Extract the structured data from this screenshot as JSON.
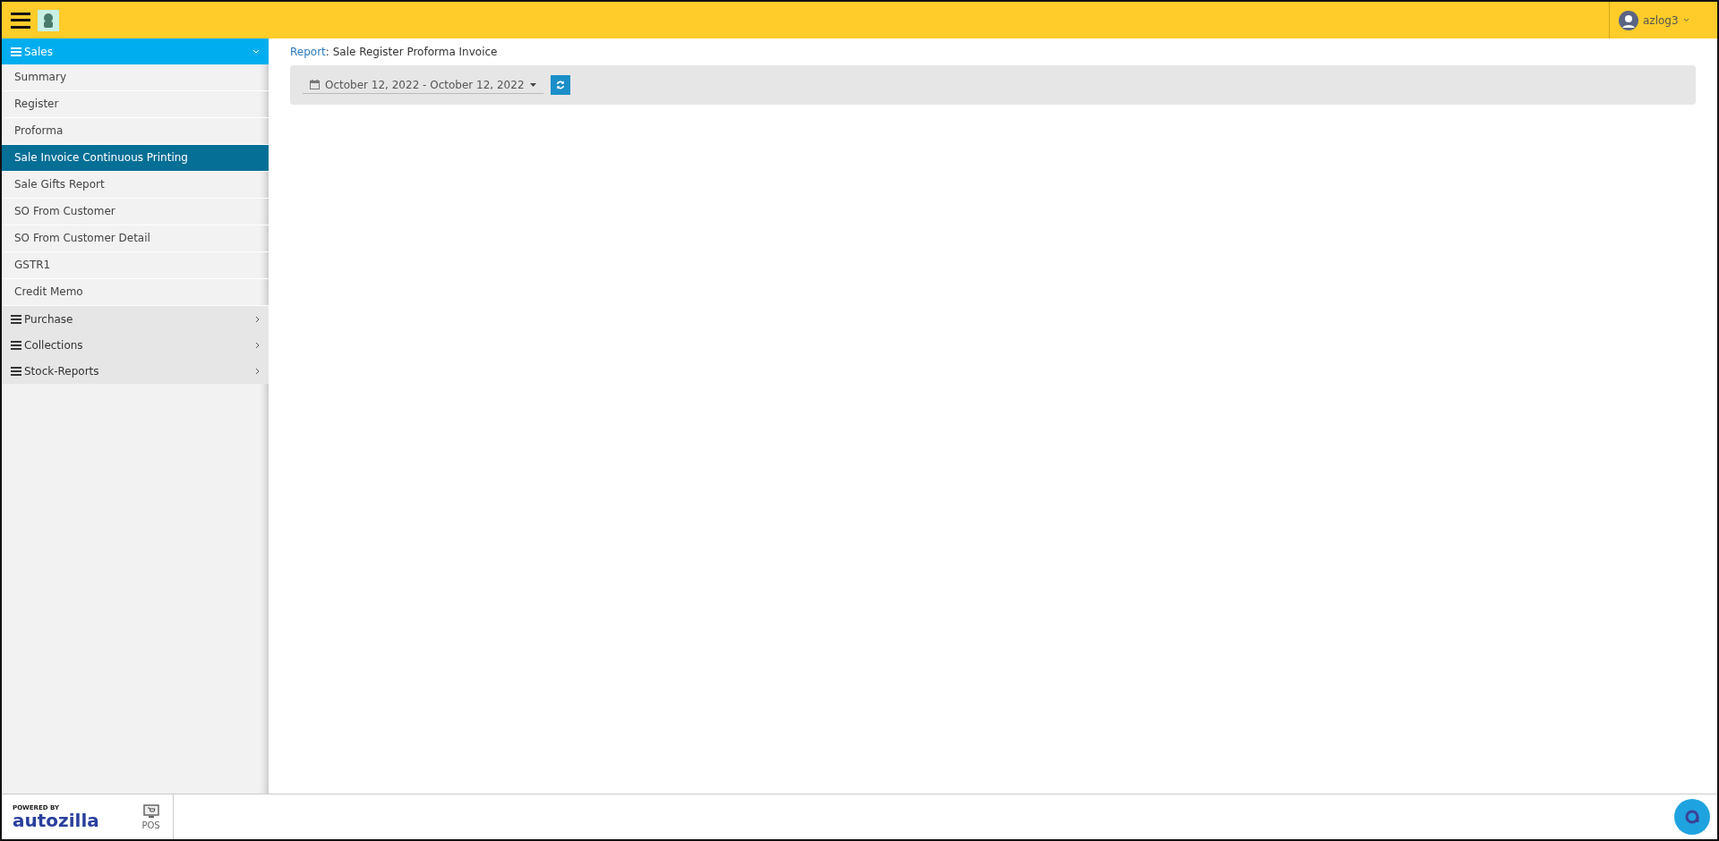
{
  "header": {
    "user": "azlog3"
  },
  "sidebar": {
    "groups": [
      {
        "label": "Sales",
        "expanded": true,
        "items": [
          {
            "label": "Summary",
            "selected": false
          },
          {
            "label": "Register",
            "selected": false
          },
          {
            "label": "Proforma",
            "selected": false
          },
          {
            "label": "Sale Invoice Continuous Printing",
            "selected": true
          },
          {
            "label": "Sale Gifts Report",
            "selected": false
          },
          {
            "label": "SO From Customer",
            "selected": false
          },
          {
            "label": "SO From Customer Detail",
            "selected": false
          },
          {
            "label": "GSTR1",
            "selected": false
          },
          {
            "label": "Credit Memo",
            "selected": false
          }
        ]
      },
      {
        "label": "Purchase",
        "expanded": false
      },
      {
        "label": "Collections",
        "expanded": false
      },
      {
        "label": "Stock-Reports",
        "expanded": false
      }
    ]
  },
  "breadcrumb": {
    "link": "Report",
    "separator": ":",
    "title": "Sale Register Proforma Invoice"
  },
  "filter": {
    "date_range": "October 12, 2022 - October 12, 2022"
  },
  "footer": {
    "powered_by": "POWERED BY",
    "brand": "autozilla",
    "pos_label": "POS"
  }
}
